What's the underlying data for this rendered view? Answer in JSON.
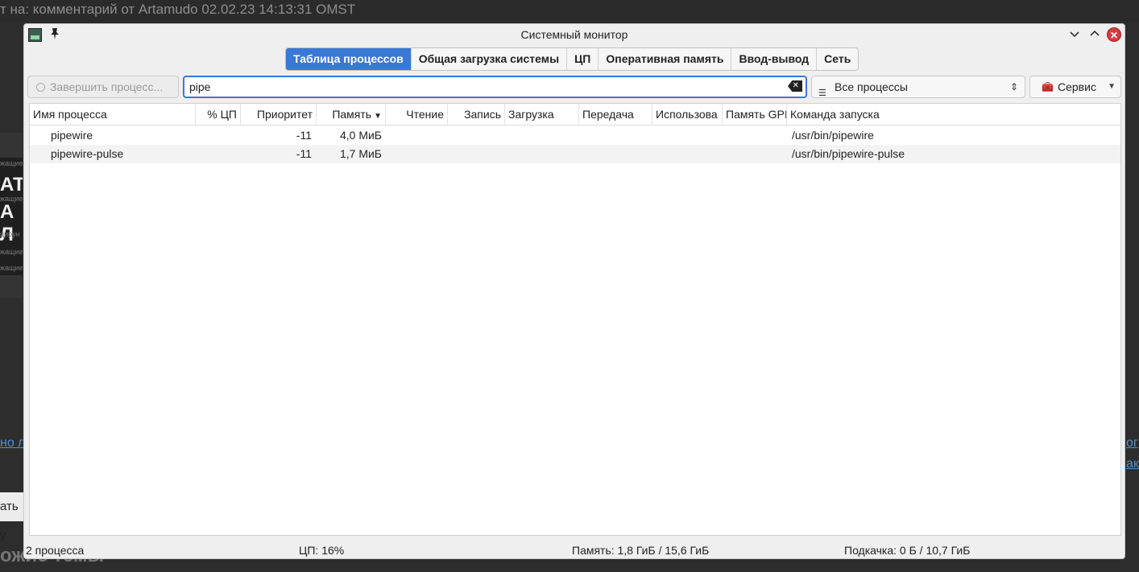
{
  "background": {
    "top_text": "т на: комментарий от Artamudo 02.02.23 14:13:31 OMST",
    "card_big_1": "АТ",
    "card_big_2": "А Л",
    "card_small_1": "жащие",
    "card_small_2": "жащие",
    "card_small_3": "цирун",
    "card_small_4": "жащие",
    "card_small_5": "жащие",
    "link_left": "но л",
    "link_right_1": "ог",
    "link_right_2": "ак",
    "button_text": "ать у",
    "bottom_text": "ожие темы"
  },
  "window": {
    "title": "Системный монитор",
    "minimize": "⌄",
    "maximize": "⌃",
    "close": "✕"
  },
  "tabs": [
    {
      "label": "Таблица процессов",
      "active": true
    },
    {
      "label": "Общая загрузка системы",
      "active": false
    },
    {
      "label": "ЦП",
      "active": false
    },
    {
      "label": "Оперативная память",
      "active": false
    },
    {
      "label": "Ввод-вывод",
      "active": false
    },
    {
      "label": "Сеть",
      "active": false
    }
  ],
  "toolbar": {
    "end_process_label": "Завершить процесс...",
    "search_value": "pipe",
    "filter_label": "Все процессы",
    "service_label": "Сервис"
  },
  "table": {
    "columns": [
      {
        "label": "Имя процесса"
      },
      {
        "label": "% ЦП"
      },
      {
        "label": "Приоритет"
      },
      {
        "label": "Память"
      },
      {
        "label": "Чтение"
      },
      {
        "label": "Запись"
      },
      {
        "label": "Загрузка"
      },
      {
        "label": "Передача"
      },
      {
        "label": "Использова"
      },
      {
        "label": "Память GPI"
      },
      {
        "label": "Команда запуска"
      }
    ],
    "sort_column": "Память",
    "rows": [
      {
        "name": "pipewire",
        "cpu": "",
        "priority": "-11",
        "memory": "4,0 МиБ",
        "command": "/usr/bin/pipewire"
      },
      {
        "name": "pipewire-pulse",
        "cpu": "",
        "priority": "-11",
        "memory": "1,7 МиБ",
        "command": "/usr/bin/pipewire-pulse"
      }
    ]
  },
  "status": {
    "count": "2 процесса",
    "cpu": "ЦП: 16%",
    "memory": "Память: 1,8 ГиБ / 15,6 ГиБ",
    "swap": "Подкачка: 0 Б / 10,7 ГиБ"
  },
  "colors": {
    "accent": "#3a78d6",
    "close": "#d43e3e"
  }
}
